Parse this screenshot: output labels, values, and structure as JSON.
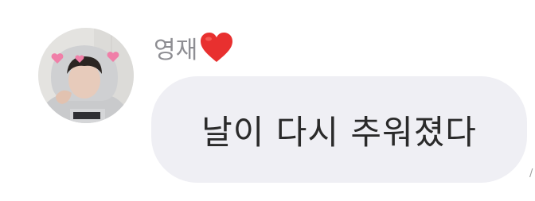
{
  "message": {
    "sender_name": "영재",
    "sender_emoji": "heart-icon",
    "text": "날이 다시 추워졌다"
  },
  "colors": {
    "background": "#ffffff",
    "bubble": "#efeff4",
    "sender_name": "#8e8e93",
    "message_text": "#2a2a2a",
    "heart": "#e8302f"
  }
}
